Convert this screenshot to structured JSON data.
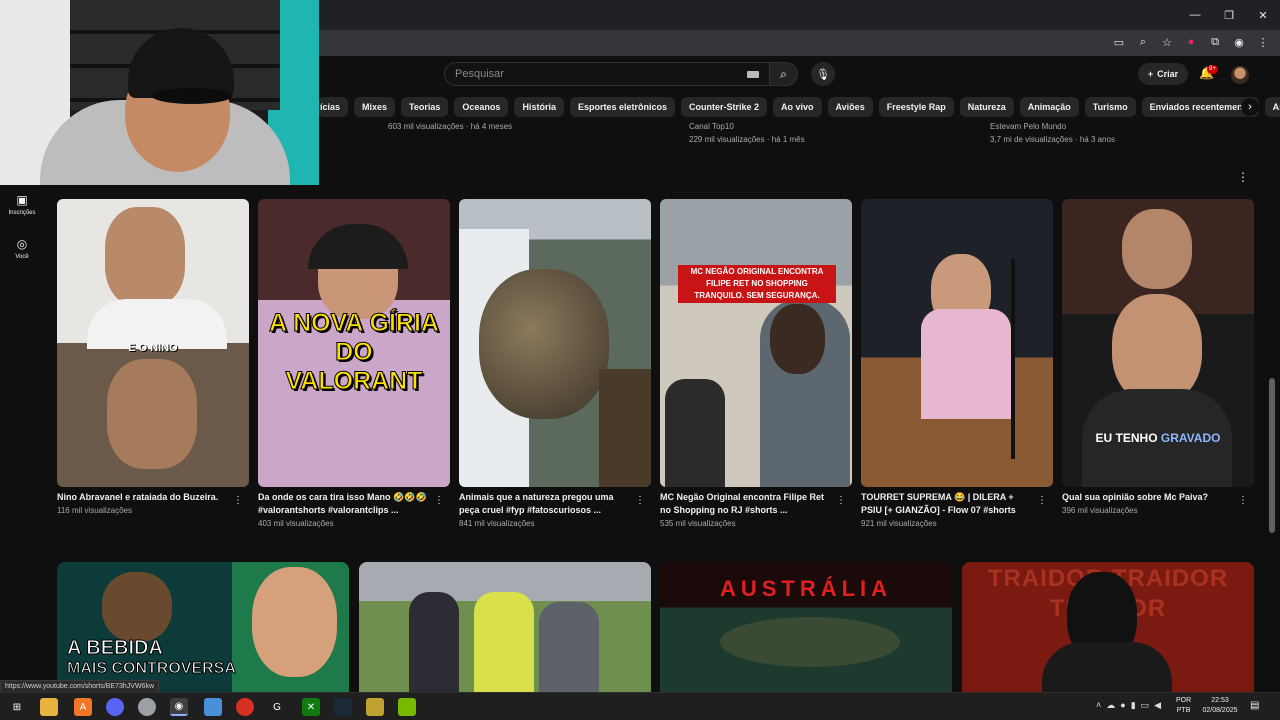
{
  "search": {
    "placeholder": "Pesquisar"
  },
  "header": {
    "create_label": "Criar",
    "notif_badge": "9+"
  },
  "chips": [
    "ícias",
    "Mixes",
    "Teorias",
    "Oceanos",
    "História",
    "Esportes eletrônicos",
    "Counter-Strike 2",
    "Ao vivo",
    "Aviões",
    "Freestyle Rap",
    "Natureza",
    "Animação",
    "Turismo",
    "Enviados recentemente",
    "Assistidos"
  ],
  "previous_row": [
    "603 mil visualizações · há 4 meses",
    "Canal Top10",
    "229 mil visualizações · há 1 mês",
    "Estevam Pelo Mundo",
    "3,7 mi de visualizações · há 3 anos"
  ],
  "rail": {
    "subscriptions": "Inscrições",
    "you": "Você"
  },
  "shorts": [
    {
      "title": "Nino Abravanel e rataiada do Buzeira.",
      "views": "116 mil visualizações",
      "overlay": "E O NINO",
      "overlay_highlight": "NINO"
    },
    {
      "title": "Da onde os cara tira isso Mano 🤣🤣🤣 #valorantshorts #valorantclips ...",
      "views": "403 mil visualizações",
      "overlay": "A NOVA GÍRIA DO VALORANT"
    },
    {
      "title": "Animais que a natureza pregou uma peça cruel #fyp #fatoscuriosos ...",
      "views": "841 mil visualizações"
    },
    {
      "title": "MC Negão Original encontra Filipe Ret no Shopping no RJ #shorts ...",
      "views": "535 mil visualizações",
      "overlay": "MC NEGÃO ORIGINAL ENCONTRA FILIPE RET NO SHOPPING TRANQUILO. SEM SEGURANÇA."
    },
    {
      "title": "TOURRET SUPREMA 😂 | DILERA + PSIU [+ GIANZÃO] - Flow 07 #shorts",
      "views": "921 mil visualizações"
    },
    {
      "title": "Qual sua opinião sobre Mc Paiva?",
      "views": "396 mil visualizações",
      "overlay_a": "EU TENHO",
      "overlay_b": "GRAVADO"
    }
  ],
  "videos": [
    {
      "overlay_a": "A BEBIDA",
      "overlay_b": "MAIS CONTROVERSA"
    },
    {},
    {
      "overlay": "AUSTRÁLIA"
    },
    {
      "overlay": "TRAIDOR TRAIDOR TRAIDOR"
    }
  ],
  "status_url": "https://www.youtube.com/shorts/BE73hJVW6kw",
  "taskbar": {
    "lang_a": "POR",
    "lang_b": "PTB",
    "time": "22:53",
    "date": "02/08/2025"
  },
  "icons": {
    "search": "search-icon",
    "mic": "mic-icon",
    "bell": "bell-icon",
    "plus": "plus-icon",
    "subscriptions": "subscriptions-icon",
    "you": "user-circle-icon",
    "more": "more-vert-icon"
  },
  "colors": {
    "bg": "#0f0f0f",
    "chip": "#272727",
    "accent_red": "#cc0000",
    "muted": "#aaaaaa"
  }
}
